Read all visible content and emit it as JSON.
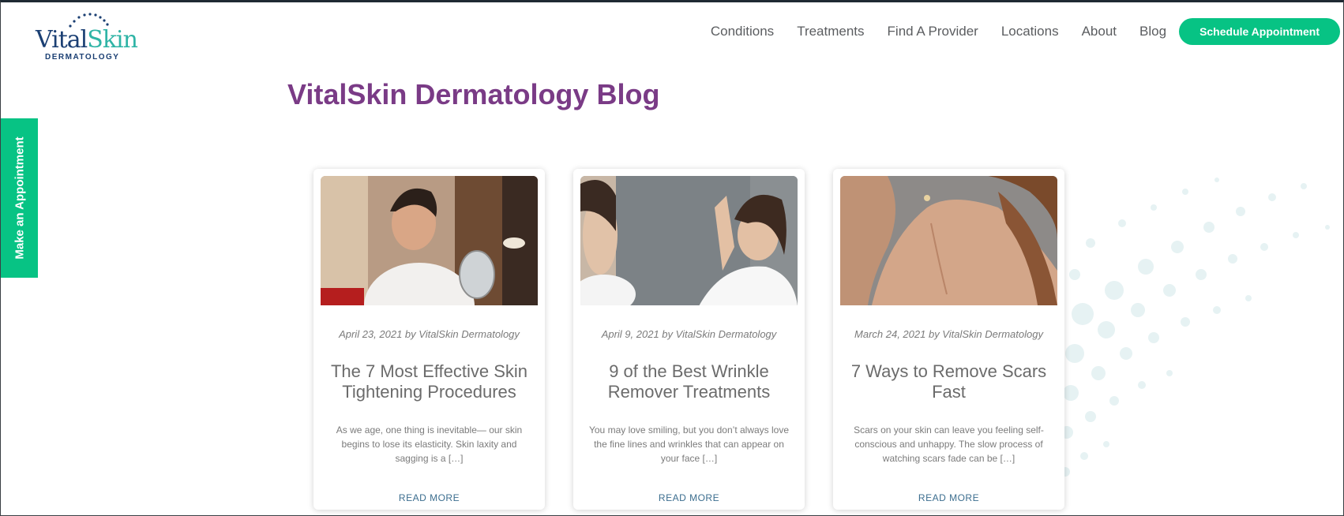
{
  "brand": {
    "name_part1": "Vital",
    "name_part2": "Skin",
    "subtitle": "DERMATOLOGY",
    "colors": {
      "navy": "#1b3f73",
      "teal": "#2fb4a6"
    }
  },
  "nav": {
    "items": [
      "Conditions",
      "Treatments",
      "Find A Provider",
      "Locations",
      "About",
      "Blog"
    ],
    "cta_label": "Schedule Appointment"
  },
  "side_tab": {
    "label": "Make an Appointment"
  },
  "page": {
    "title": "VitalSkin Dermatology Blog"
  },
  "colors": {
    "accent_green": "#07c384",
    "title_purple": "#7a3b86",
    "link_blue": "#3c6e8f"
  },
  "posts": [
    {
      "meta": "April 23, 2021 by VitalSkin Dermatology",
      "title": "The 7 Most Effective Skin Tightening Procedures",
      "excerpt": "As we age, one thing is inevitable— our skin begins to lose its elasticity. Skin laxity and sagging is a […]",
      "read_more": "READ MORE"
    },
    {
      "meta": "April 9, 2021 by VitalSkin Dermatology",
      "title": "9 of the Best Wrinkle Remover Treatments",
      "excerpt": "You may love smiling, but you don’t always love the fine lines and wrinkles that can appear on your face […]",
      "read_more": "READ MORE"
    },
    {
      "meta": "March 24, 2021 by VitalSkin Dermatology",
      "title": "7 Ways to Remove Scars Fast",
      "excerpt": "Scars on your skin can leave you feeling self-conscious and unhappy. The slow process of watching scars fade can be […]",
      "read_more": "READ MORE"
    }
  ]
}
